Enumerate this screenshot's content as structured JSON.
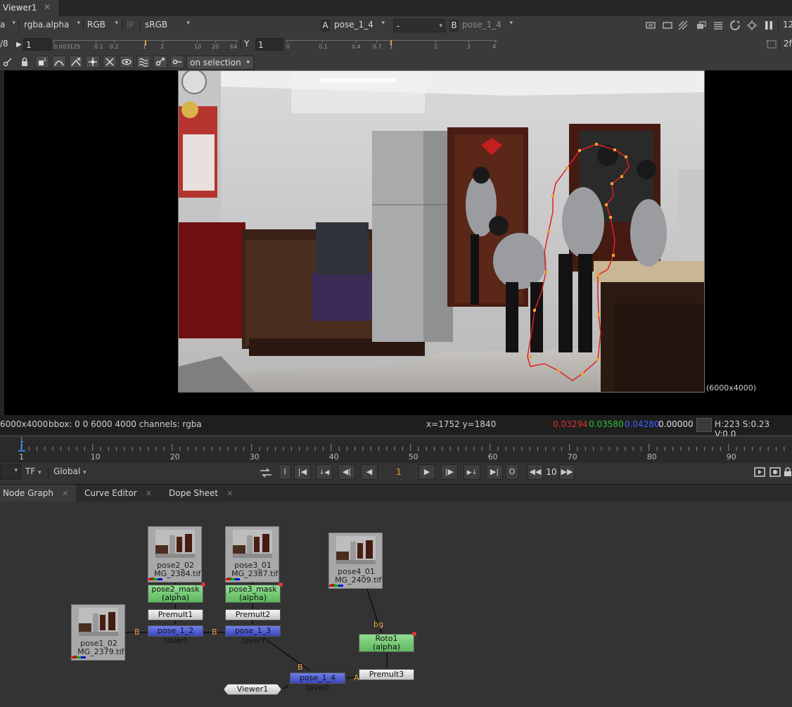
{
  "tabs": {
    "viewer": "Viewer1",
    "close": "✕"
  },
  "toolbar": {
    "channels_left": "a",
    "channel_alpha": "rgba.alpha",
    "color_rgb": "RGB",
    "ip": "IP",
    "lut": "sRGB",
    "a_label": "A",
    "a_input": "pose_1_4",
    "compare": "-",
    "b_label": "B",
    "b_input": "pose_1_4",
    "zoom_right": "12"
  },
  "sliders": {
    "proxy": "/8",
    "gain_value": "1",
    "gain_ticks": [
      "0.0",
      "03125",
      "0.1",
      "0.2",
      "1",
      "2",
      "10",
      "20",
      "64"
    ],
    "y_label": "Y",
    "gamma_value": "1",
    "gamma_ticks": [
      "0",
      "0.1",
      "0.4",
      "0.7",
      "1",
      "2",
      "3",
      "4"
    ],
    "right_label": "2f"
  },
  "roto": {
    "selection_mode": "on selection"
  },
  "viewer": {
    "format": "(6000x4000)"
  },
  "info": {
    "format": "6000x4000",
    "bbox": "bbox: 0 0 6000 4000 channels: rgba",
    "coords": "x=1752 y=1840",
    "r": "0.03294",
    "g": "0.03580",
    "b": "0.04280",
    "a": "0.00000",
    "hsv": "H:223 S:0.23 V:0.0",
    "colors": {
      "r": "#e03030",
      "g": "#30c030",
      "b": "#4060ff",
      "a": "#e0e0e0"
    }
  },
  "timeline": {
    "ticks": [
      "1",
      "10",
      "20",
      "30",
      "40",
      "50",
      "60",
      "70",
      "80",
      "90"
    ],
    "current_marker": "1",
    "tf": "TF",
    "global": "Global",
    "frame": "1",
    "step": "10",
    "in_btn": "I",
    "out_btn": "O"
  },
  "panels": {
    "node_graph": "Node Graph",
    "curve_editor": "Curve Editor",
    "dope_sheet": "Dope Sheet",
    "close": "✕"
  },
  "nodes": {
    "pose2_read": {
      "l1": "pose2_02",
      "l2": "_MG_2384.tif"
    },
    "pose3_read": {
      "l1": "pose3_01",
      "l2": "_MG_2387.tif"
    },
    "pose4_read": {
      "l1": "pose4_01",
      "l2": "_MG_2409.tif"
    },
    "pose1_read": {
      "l1": "pose1_02",
      "l2": "_MG_2379.tif"
    },
    "pose2_mask": {
      "l1": "pose2_mask",
      "l2": "(alpha)"
    },
    "pose3_mask": {
      "l1": "pose3_mask",
      "l2": "(alpha)"
    },
    "premult1": "Premult1",
    "premult2": "Premult2",
    "premult3": "Premult3",
    "merge12": "pose_1_2 (over)",
    "merge13": "pose_1_3 (over)",
    "merge14": "pose_1_4 (over)",
    "roto1": {
      "l1": "Roto1",
      "l2": "(alpha)"
    },
    "viewer1": "Viewer1",
    "pin_b": "B",
    "pin_a": "A",
    "pin_bg": "bg"
  }
}
